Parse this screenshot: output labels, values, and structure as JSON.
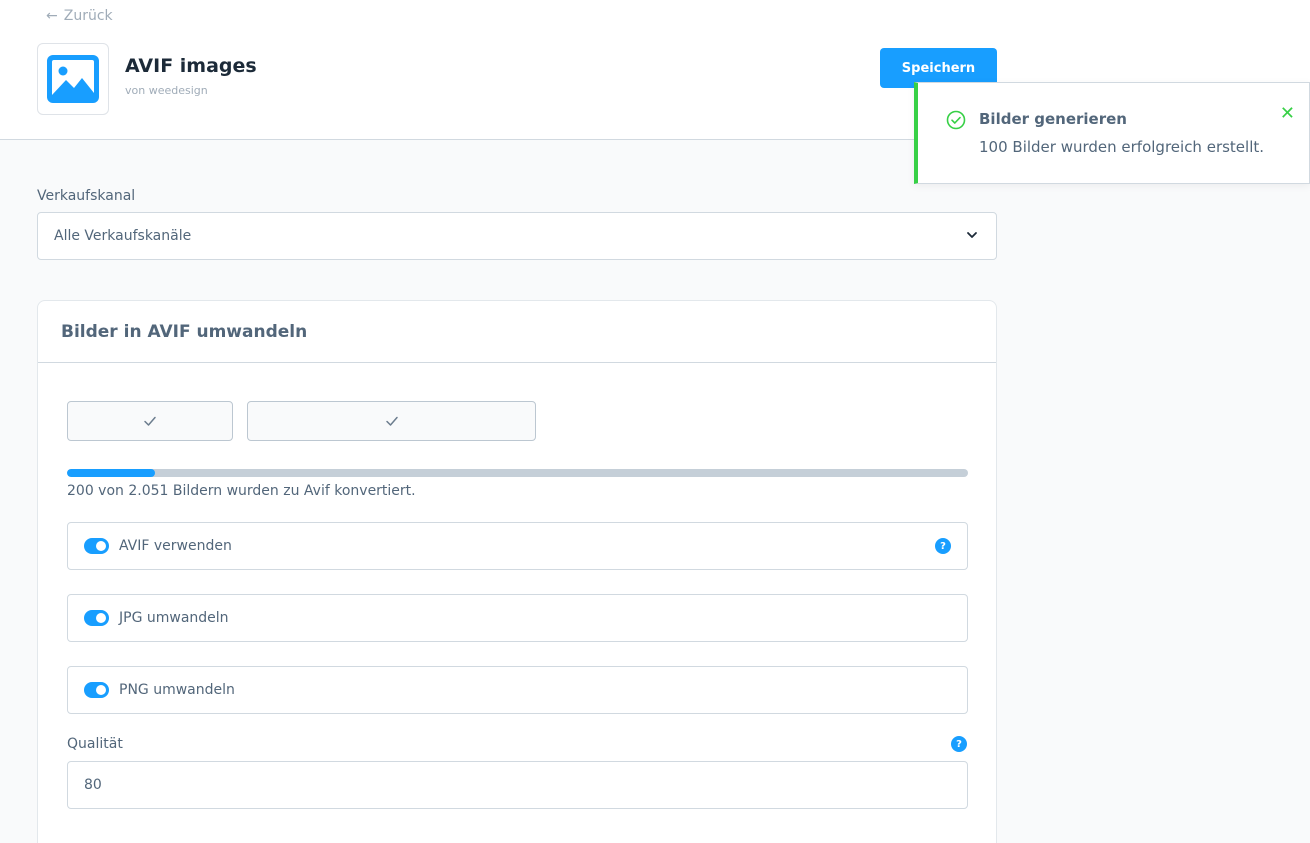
{
  "header": {
    "back_label": "Zurück",
    "app_title": "AVIF images",
    "app_vendor": "von weedesign",
    "save_label": "Speichern"
  },
  "notification": {
    "title": "Bilder generieren",
    "message": "100 Bilder wurden erfolgreich erstellt.",
    "status": "success"
  },
  "sales_channel": {
    "label": "Verkaufskanal",
    "selected": "Alle Verkaufskanäle"
  },
  "card": {
    "title": "Bilder in AVIF umwandeln",
    "progress": {
      "converted": 200,
      "total": 2051,
      "fraction": 0.0975,
      "text": "200 von 2.051 Bildern wurden zu Avif konvertiert."
    },
    "toggles": [
      {
        "label": "AVIF verwenden",
        "on": true,
        "help": true
      },
      {
        "label": "JPG umwandeln",
        "on": true,
        "help": false
      },
      {
        "label": "PNG umwandeln",
        "on": true,
        "help": false
      }
    ],
    "quality": {
      "label": "Qualität",
      "value": "80"
    }
  },
  "colors": {
    "primary": "#189eff",
    "success": "#37d046",
    "text": "#52667a",
    "border": "#d1d9e0"
  },
  "icons": {
    "back": "arrow-left-icon",
    "app": "image-icon",
    "toast_status": "check-circle-icon",
    "toast_close": "close-icon",
    "select": "chevron-down-icon",
    "buttons": "checkmark-icon",
    "help": "question-circle-icon"
  }
}
